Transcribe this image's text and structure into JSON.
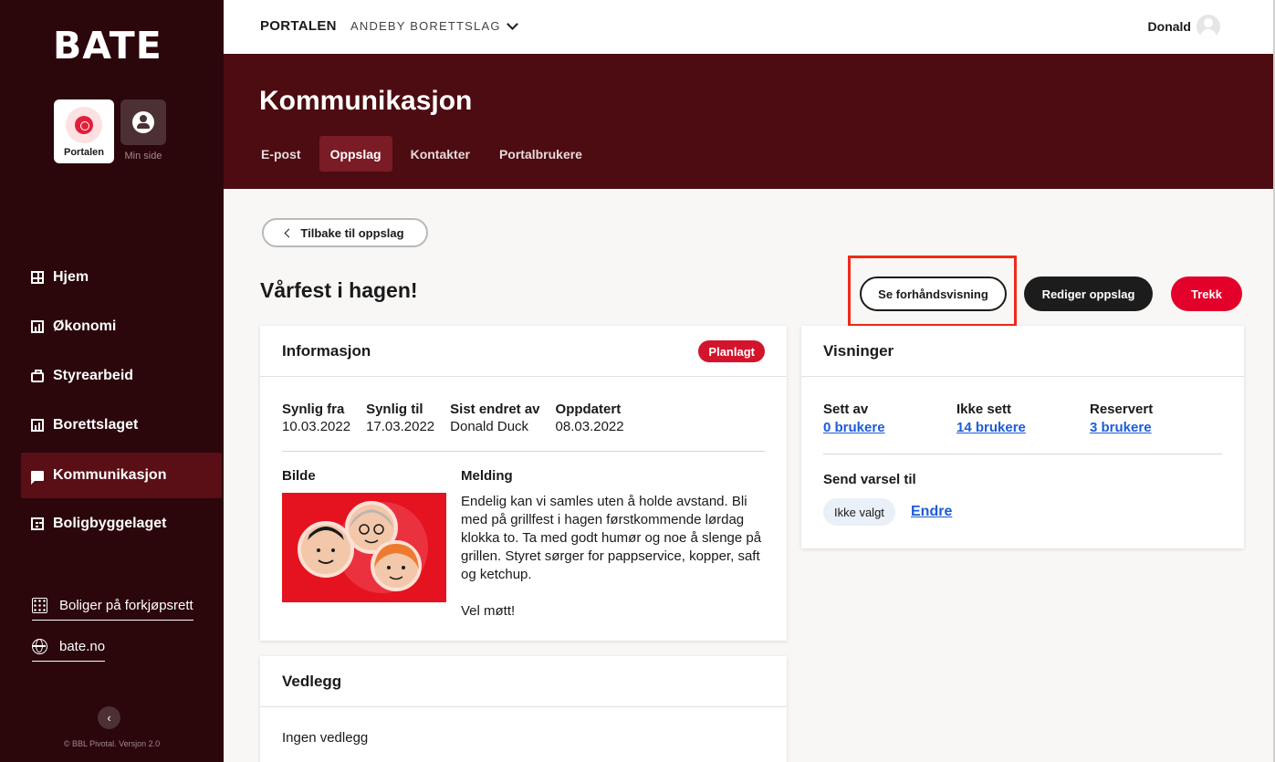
{
  "sidebar": {
    "logo": "BATE",
    "switcher": {
      "portalen": "Portalen",
      "min_side": "Min side"
    },
    "nav": [
      {
        "label": "Hjem",
        "icon": "dashboard-icon"
      },
      {
        "label": "Økonomi",
        "icon": "chart-icon"
      },
      {
        "label": "Styrearbeid",
        "icon": "briefcase-icon"
      },
      {
        "label": "Borettslaget",
        "icon": "chart-icon"
      },
      {
        "label": "Kommunikasjon",
        "icon": "chat-icon",
        "active": true
      },
      {
        "label": "Boligbyggelaget",
        "icon": "building-icon"
      }
    ],
    "links": [
      {
        "label": "Boliger på forkjøpsrett",
        "icon": "grid-dots-icon"
      },
      {
        "label": "bate.no",
        "icon": "globe-icon"
      }
    ],
    "copyright": "© BBL Pivotal. Versjon 2.0"
  },
  "topbar": {
    "portal": "PORTALEN",
    "org": "ANDEBY BORETTSLAG",
    "user": "Donald"
  },
  "header": {
    "title": "Kommunikasjon",
    "tabs": [
      {
        "label": "E-post"
      },
      {
        "label": "Oppslag",
        "active": true
      },
      {
        "label": "Kontakter"
      },
      {
        "label": "Portalbrukere"
      }
    ]
  },
  "content": {
    "back": "Tilbake til oppslag",
    "title": "Vårfest i hagen!",
    "actions": {
      "preview": "Se forhåndsvisning",
      "edit": "Rediger oppslag",
      "withdraw": "Trekk"
    },
    "info": {
      "heading": "Informasjon",
      "status": "Planlagt",
      "fields": [
        {
          "k": "Synlig fra",
          "v": "10.03.2022"
        },
        {
          "k": "Synlig til",
          "v": "17.03.2022"
        },
        {
          "k": "Sist endret av",
          "v": "Donald Duck"
        },
        {
          "k": "Oppdatert",
          "v": "08.03.2022"
        }
      ],
      "image_label": "Bilde",
      "message_label": "Melding",
      "message": "Endelig kan vi samles uten å holde avstand. Bli med på grillfest i hagen førstkommende lørdag klokka to. Ta med godt humør og noe å slenge på grillen. Styret sørger for pappservice, kopper, saft og ketchup.",
      "message_end": "Vel møtt!"
    },
    "views": {
      "heading": "Visninger",
      "stats": [
        {
          "k": "Sett av",
          "v": "0 brukere"
        },
        {
          "k": "Ikke sett",
          "v": "14 brukere"
        },
        {
          "k": "Reservert",
          "v": "3 brukere"
        }
      ],
      "notify_label": "Send varsel til",
      "notify_value": "Ikke valgt",
      "change": "Endre"
    },
    "attachments": {
      "heading": "Vedlegg",
      "empty": "Ingen vedlegg"
    }
  },
  "colors": {
    "sidebar": "#2b060b",
    "band": "#4d0b12",
    "accent_red": "#e3002b",
    "link": "#1e5bd7",
    "highlight": "#f02a1a"
  }
}
